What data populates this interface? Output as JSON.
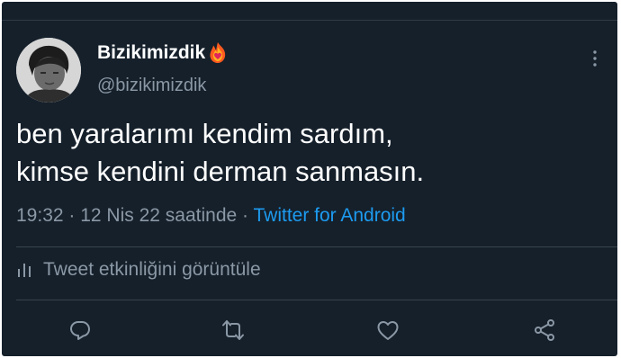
{
  "tweet": {
    "display_name": "Bizikimizdik",
    "display_name_badge": "fire-heart-icon",
    "username": "@bizikimizdik",
    "text_line1": "ben yaralarımı kendim sardım,",
    "text_line2": "kimse kendini derman sanmasın.",
    "time": "19:32",
    "separator1": " · ",
    "date": "12 Nis 22 saatinde",
    "separator2": " · ",
    "source": "Twitter for Android"
  },
  "activity": {
    "label": "Tweet etkinliğini görüntüle"
  },
  "actions": [
    "reply-icon",
    "retweet-icon",
    "like-icon",
    "share-icon"
  ],
  "colors": {
    "background": "#15202b",
    "text": "#ffffff",
    "secondary_text": "#8b98a5",
    "link": "#1d9bf0",
    "divider": "#38444d"
  }
}
